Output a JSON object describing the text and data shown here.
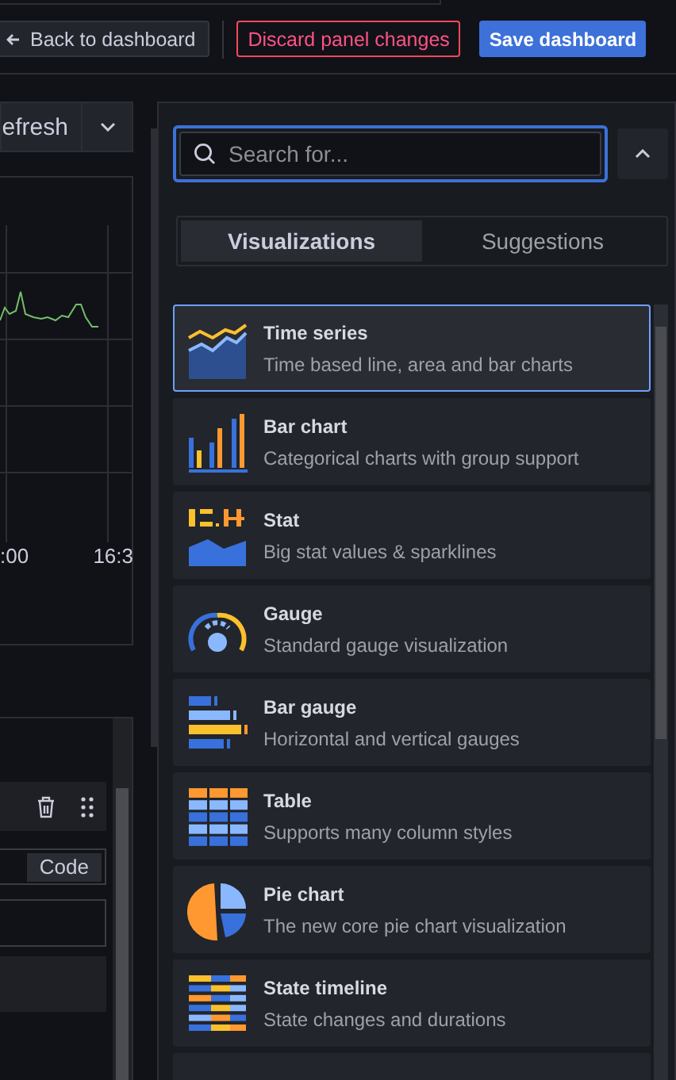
{
  "toolbar": {
    "back_button": "Back to dashboard",
    "discard_button": "Discard panel changes",
    "save_button": "Save dashboard"
  },
  "refresh_button": "efresh",
  "chart": {
    "x_labels": [
      ":00",
      "16:3"
    ]
  },
  "query_editor": {
    "code_button": "Code"
  },
  "search": {
    "placeholder": "Search for..."
  },
  "tabs": [
    {
      "label": "Visualizations",
      "selected": true
    },
    {
      "label": "Suggestions",
      "selected": false
    }
  ],
  "visualizations": [
    {
      "kind": "timeseries",
      "name": "Time series",
      "description": "Time based line, area and bar charts",
      "selected": true
    },
    {
      "kind": "barchart",
      "name": "Bar chart",
      "description": "Categorical charts with group support",
      "selected": false
    },
    {
      "kind": "stat",
      "name": "Stat",
      "description": "Big stat values & sparklines",
      "selected": false
    },
    {
      "kind": "gauge",
      "name": "Gauge",
      "description": "Standard gauge visualization",
      "selected": false
    },
    {
      "kind": "bargauge",
      "name": "Bar gauge",
      "description": "Horizontal and vertical gauges",
      "selected": false
    },
    {
      "kind": "table",
      "name": "Table",
      "description": "Supports many column styles",
      "selected": false
    },
    {
      "kind": "piechart",
      "name": "Pie chart",
      "description": "The new core pie chart visualization",
      "selected": false
    },
    {
      "kind": "statetimeline",
      "name": "State timeline",
      "description": "State changes and durations",
      "selected": false
    }
  ]
}
